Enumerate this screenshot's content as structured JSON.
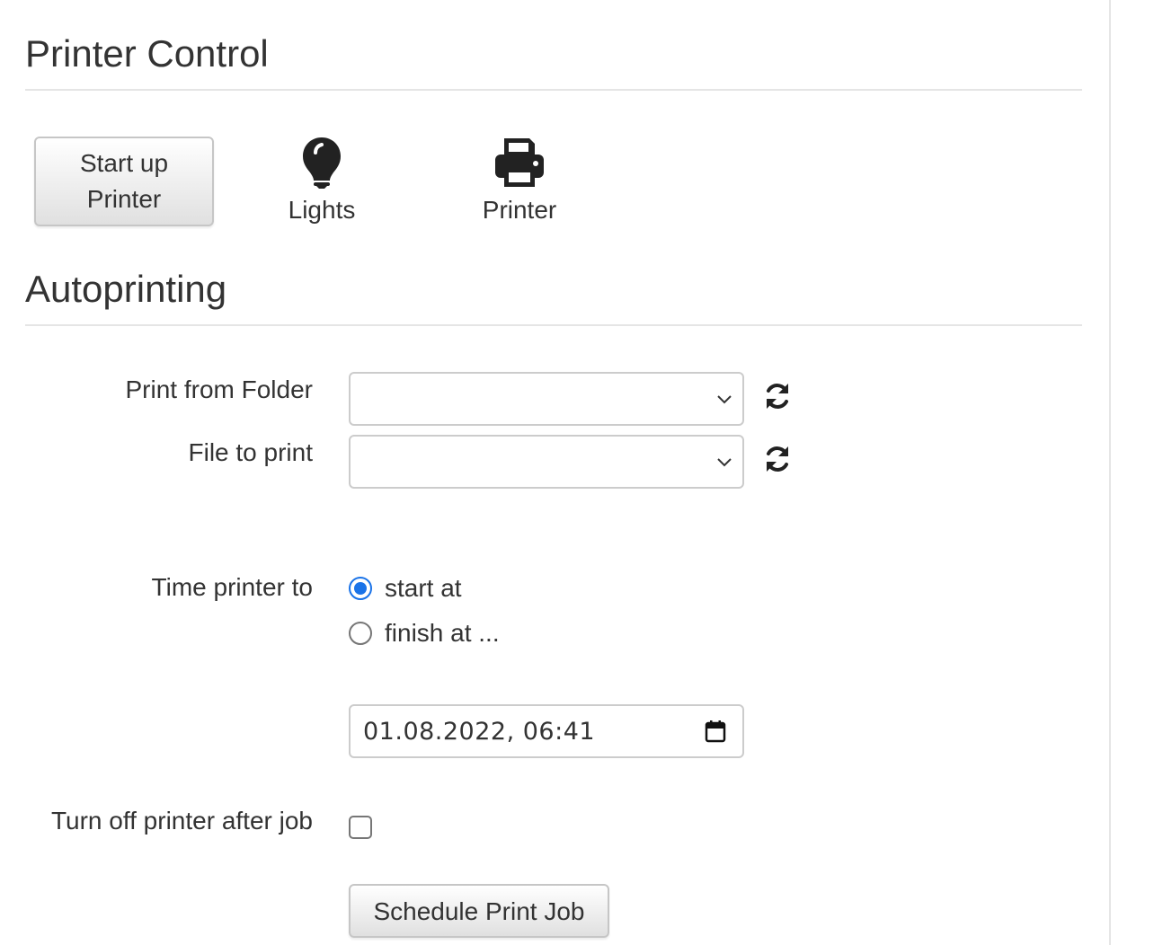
{
  "printer_control": {
    "heading": "Printer Control",
    "startup_button": {
      "line1": "Start up",
      "line2": "Printer"
    },
    "lights": {
      "label": "Lights",
      "icon": "lightbulb-icon"
    },
    "printer": {
      "label": "Printer",
      "icon": "printer-icon"
    }
  },
  "autoprinting": {
    "heading": "Autoprinting",
    "folder": {
      "label": "Print from Folder",
      "value": "",
      "refresh_icon": "refresh-icon"
    },
    "file": {
      "label": "File to print",
      "value": "",
      "refresh_icon": "refresh-icon"
    },
    "timing": {
      "label": "Time printer to",
      "options": [
        {
          "label": "start at",
          "checked": true
        },
        {
          "label": "finish at ...",
          "checked": false
        }
      ]
    },
    "datetime": {
      "value": "01.08.2022, 06:41",
      "icon": "calendar-icon"
    },
    "turn_off": {
      "label": "Turn off printer after job",
      "checked": false
    },
    "schedule_button": "Schedule Print Job"
  },
  "colors": {
    "accent": "#1a73e8",
    "text": "#333333",
    "border": "#cccccc"
  }
}
